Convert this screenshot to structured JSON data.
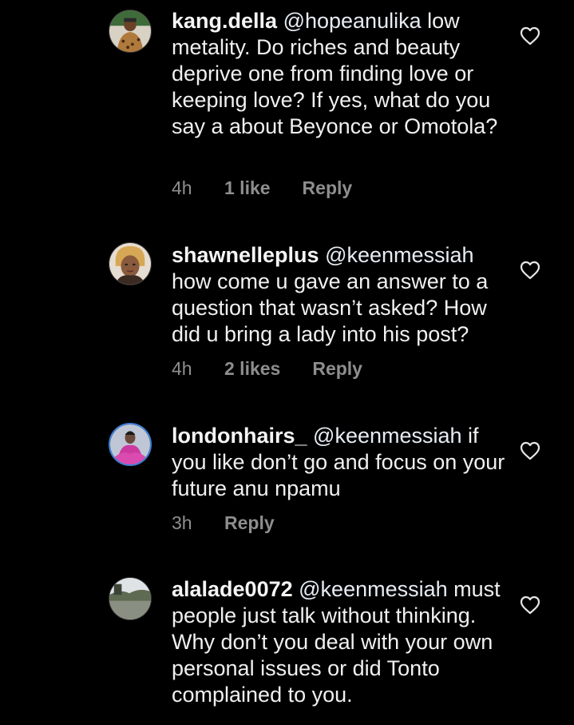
{
  "comments": [
    {
      "username": "kang.della",
      "mention": "@hopeanulika",
      "text": " low metality. Do riches and beauty deprive one from finding love or keeping love? If yes, what do you say a about Beyonce or Omotola?",
      "time": "4h",
      "likes": "1 like",
      "reply": "Reply",
      "avatar_icon": "leopard-print-avatar",
      "avatar_color": "#b07a3c"
    },
    {
      "username": "shawnelleplus",
      "mention": "@keenmessiah",
      "text": " how come u gave an answer to a question that wasn’t asked? How did u bring a lady into his post?",
      "time": "4h",
      "likes": "2 likes",
      "reply": "Reply",
      "avatar_icon": "woman-portrait-avatar",
      "avatar_color": "#c9a07a"
    },
    {
      "username": "londonhairs_",
      "mention": "@keenmessiah",
      "text": " if you like don’t go and focus on your future anu npamu",
      "time": "3h",
      "likes": "",
      "reply": "Reply",
      "avatar_icon": "pink-dress-avatar",
      "avatar_color": "#cc3aa0"
    },
    {
      "username": "alalade0072",
      "mention": "@keenmessiah",
      "text": " must people just talk without thinking. Why don’t you deal with your own personal issues or did Tonto complained to you.",
      "time": "",
      "likes": "",
      "reply": "",
      "avatar_icon": "landscape-avatar",
      "avatar_color": "#8a8f84"
    }
  ],
  "icons": {
    "heart": "heart-outline-icon"
  },
  "colors": {
    "background": "#000000",
    "text": "#f0f0f0",
    "meta": "#8e8e8e"
  }
}
